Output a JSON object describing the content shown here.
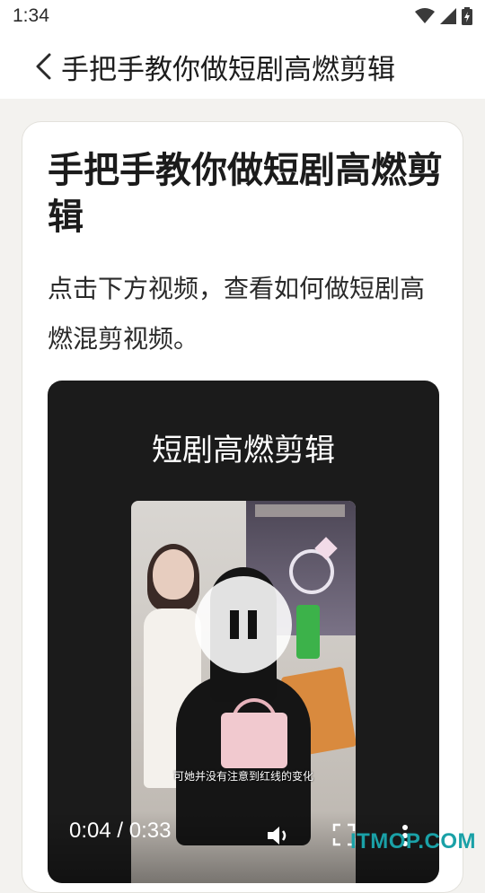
{
  "status_bar": {
    "time": "1:34",
    "icons": [
      "wifi-icon",
      "signal-icon",
      "battery-icon"
    ]
  },
  "app_bar": {
    "back_icon": "chevron-left-icon",
    "title": "手把手教你做短剧高燃剪辑"
  },
  "card": {
    "title": "手把手教你做短剧高燃剪辑",
    "description": "点击下方视频，查看如何做短剧高燃混剪视频。"
  },
  "video": {
    "heading": "短剧高燃剪辑",
    "subtitle": "可她并没有注意到红线的变化",
    "playback_state": "playing",
    "current_time": "0:04",
    "duration": "0:33",
    "time_readout": "0:04 / 0:33",
    "controls": [
      "pause-icon",
      "volume-icon",
      "fullscreen-icon",
      "more-vert-icon"
    ]
  },
  "watermark": "ITMOP.COM",
  "colors": {
    "background": "#f3f2ef",
    "card": "#ffffff",
    "player": "#1b1b1b",
    "watermark": "#1aa1a7"
  }
}
